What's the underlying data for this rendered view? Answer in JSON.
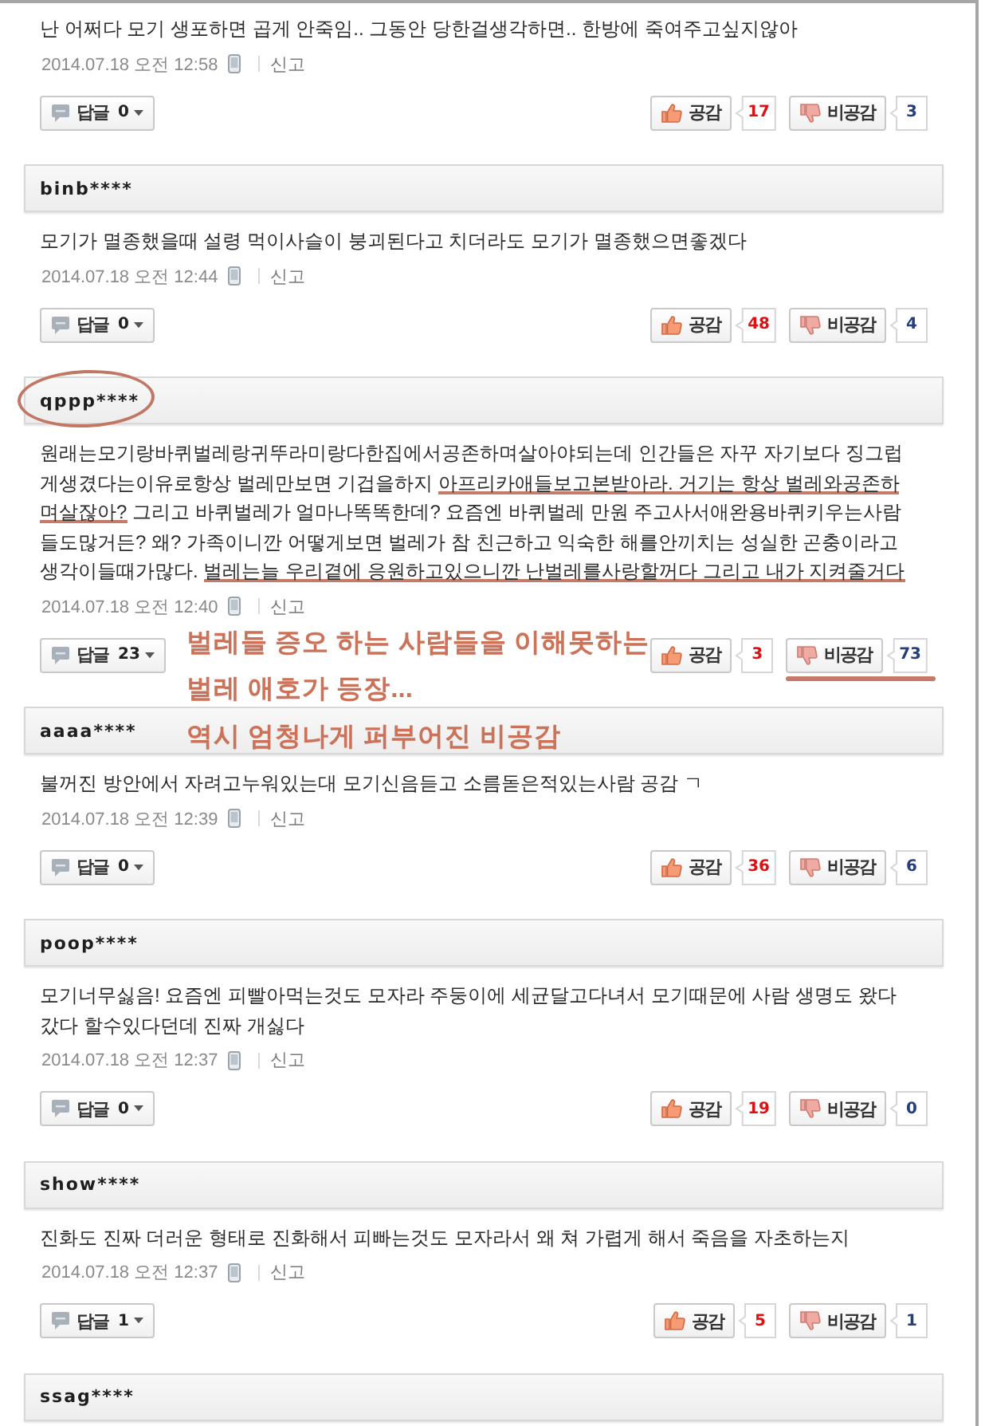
{
  "comments": [
    {
      "body": [
        {
          "text": "난 어쩌다 모기 생포하면 곱게 안죽임.. 그동안 당한걸생각하면.. 한방에 죽여주고싶지않아",
          "underlined": false
        }
      ],
      "date": "2014.07.18 오전 12:58",
      "report": "신고",
      "reply": {
        "label": "답글",
        "count": "0"
      },
      "like": {
        "label": "공감",
        "count": "17"
      },
      "dislike": {
        "label": "비공감",
        "count": "3",
        "underlined": false
      }
    },
    {
      "user": "binb****",
      "circled": false,
      "body": [
        {
          "text": "모기가 멸종했을때 설령 먹이사슬이 붕괴된다고 치더라도 모기가 멸종했으면좋겠다",
          "underlined": false
        }
      ],
      "date": "2014.07.18 오전 12:44",
      "report": "신고",
      "reply": {
        "label": "답글",
        "count": "0"
      },
      "like": {
        "label": "공감",
        "count": "48"
      },
      "dislike": {
        "label": "비공감",
        "count": "4",
        "underlined": false
      }
    },
    {
      "user": "qppp****",
      "circled": true,
      "body": [
        {
          "text": "원래는모기랑바퀴벌레랑귀뚜라미랑다한집에서공존하며살아야되는데 인간들은 자꾸 자기보다 징그럽게생겼다는이유로항상 벌레만보면 기겁을하지 ",
          "underlined": false
        },
        {
          "text": "아프리카애들보고본받아라. 거기는 항상 벌레와공존하며살잖아?",
          "underlined": true
        },
        {
          "text": " 그리고 바퀴벌레가 얼마나똑똑한데? 요즘엔 바퀴벌레 만원 주고사서애완용바퀴키우는사람들도많거든? 왜? 가족이니깐 어떻게보면 벌레가 참 친근하고 익숙한 해를안끼치는 성실한 곤충이라고 생각이들때가많다. ",
          "underlined": false
        },
        {
          "text": "벌레는늘 우리곁에 응원하고있으니깐 난벌레를사랑할꺼다 그리고 내가 지켜줄거다",
          "underlined": true
        }
      ],
      "date": "2014.07.18 오전 12:40",
      "report": "신고",
      "reply": {
        "label": "답글",
        "count": "23"
      },
      "like": {
        "label": "공감",
        "count": "3"
      },
      "dislike": {
        "label": "비공감",
        "count": "73",
        "underlined": true
      },
      "annotation": {
        "lines": [
          "벌레들 증오 하는 사람들을 이해못하는",
          "벌레 애호가 등장...",
          "역시 엄청나게 퍼부어진 비공감"
        ]
      }
    },
    {
      "user": "aaaa****",
      "circled": false,
      "body": [
        {
          "text": "불꺼진 방안에서 자려고누워있는대 모기신음듣고 소름돋은적있는사람 공감 ㄱ",
          "underlined": false
        }
      ],
      "date": "2014.07.18 오전 12:39",
      "report": "신고",
      "reply": {
        "label": "답글",
        "count": "0"
      },
      "like": {
        "label": "공감",
        "count": "36"
      },
      "dislike": {
        "label": "비공감",
        "count": "6",
        "underlined": false
      }
    },
    {
      "user": "poop****",
      "circled": false,
      "body": [
        {
          "text": "모기너무싫음! 요즘엔 피빨아먹는것도 모자라 주둥이에 세균달고다녀서 모기때문에 사람 생명도 왔다갔다 할수있다던데 진짜 개싫다",
          "underlined": false
        }
      ],
      "date": "2014.07.18 오전 12:37",
      "report": "신고",
      "reply": {
        "label": "답글",
        "count": "0"
      },
      "like": {
        "label": "공감",
        "count": "19"
      },
      "dislike": {
        "label": "비공감",
        "count": "0",
        "underlined": false
      }
    },
    {
      "user": "show****",
      "circled": false,
      "body": [
        {
          "text": "진화도 진짜 더러운 형태로 진화해서 피빠는것도 모자라서 왜 쳐 가렵게 해서 죽음을 자초하는지",
          "underlined": false
        }
      ],
      "date": "2014.07.18 오전 12:37",
      "report": "신고",
      "reply": {
        "label": "답글",
        "count": "1"
      },
      "like": {
        "label": "공감",
        "count": "5"
      },
      "dislike": {
        "label": "비공감",
        "count": "1",
        "underlined": false
      }
    },
    {
      "user": "ssag****",
      "circled": false
    }
  ]
}
